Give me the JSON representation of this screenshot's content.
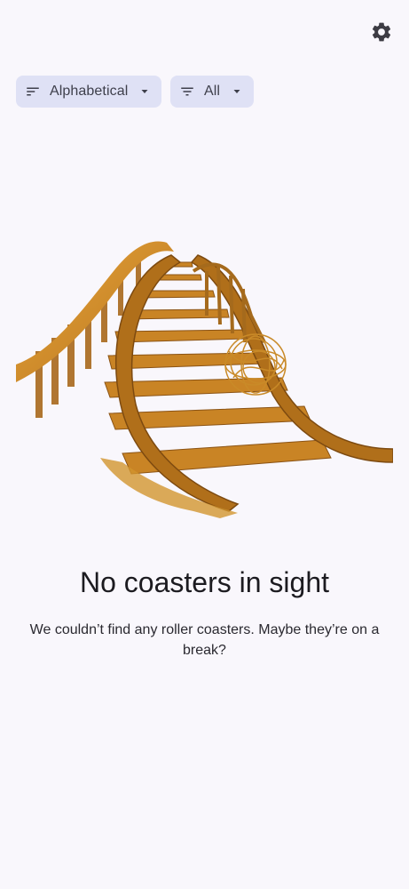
{
  "toolbar": {
    "settings_icon": "gear-icon"
  },
  "filters": {
    "sort": {
      "label": "Alphabetical",
      "icon": "sort-icon",
      "trailing_icon": "dropdown-arrow-icon"
    },
    "filter": {
      "label": "All",
      "icon": "filter-icon",
      "trailing_icon": "dropdown-arrow-icon"
    }
  },
  "empty_state": {
    "illustration": "wooden-roller-coaster-track-with-tumbleweed",
    "title": "No coasters in sight",
    "message": "We couldn’t find any roller coasters. Maybe they’re on a break?"
  },
  "colors": {
    "background": "#f9f7fc",
    "chip_background": "#dfe1f5",
    "text_primary": "#1c1b20",
    "wood": "#d18e2a"
  }
}
